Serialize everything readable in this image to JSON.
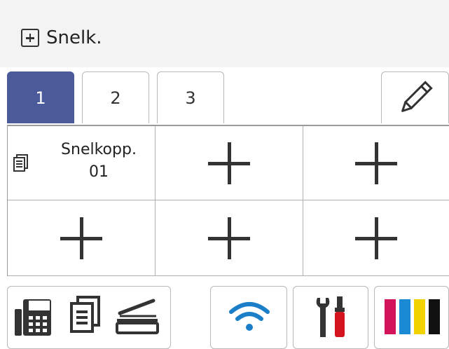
{
  "header": {
    "title": "Snelk.",
    "icon": "add-box-icon"
  },
  "tabs": [
    {
      "label": "1",
      "active": true
    },
    {
      "label": "2",
      "active": false
    },
    {
      "label": "3",
      "active": false
    }
  ],
  "edit_icon": "pencil-icon",
  "shortcuts": [
    {
      "label_line1": "Snelkopp.",
      "label_line2": "01",
      "icon": "copy-document-icon"
    },
    {
      "icon": "plus-icon"
    },
    {
      "icon": "plus-icon"
    },
    {
      "icon": "plus-icon"
    },
    {
      "icon": "plus-icon"
    },
    {
      "icon": "plus-icon"
    }
  ],
  "bottom_bar": [
    {
      "icons": [
        "fax-icon",
        "copy-icon",
        "scan-icon"
      ]
    },
    {
      "icons": [
        "wifi-icon"
      ],
      "color": "#1a7ec8"
    },
    {
      "icons": [
        "settings-tools-icon"
      ]
    },
    {
      "icons": [
        "ink-icon"
      ],
      "colors": [
        "#d4145a",
        "#1a8ad4",
        "#f2d300",
        "#111111"
      ]
    }
  ],
  "colors": {
    "accent": "#4a5a9a",
    "header_bg": "#f3f3f3"
  }
}
